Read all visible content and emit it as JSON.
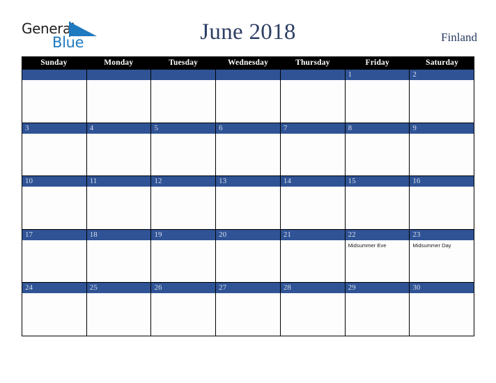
{
  "brand": {
    "word_one": "General",
    "word_two": "Blue",
    "triangle_icon": "blue-triangle-icon",
    "colors": {
      "general_text": "#231f20",
      "blue_text": "#1f7ac0",
      "triangle": "#1f7ac0"
    }
  },
  "header": {
    "title": "June 2018",
    "country": "Finland",
    "title_color": "#2c3e63"
  },
  "theme": {
    "header_row_bg": "#000000",
    "date_bar_bg": "#2f5395",
    "date_bar_text": "#d9dff0",
    "cell_bg": "#fdfdfd",
    "grid_line": "#000000"
  },
  "calendar": {
    "day_headers": [
      "Sunday",
      "Monday",
      "Tuesday",
      "Wednesday",
      "Thursday",
      "Friday",
      "Saturday"
    ],
    "weeks": [
      [
        {
          "day": "",
          "events": []
        },
        {
          "day": "",
          "events": []
        },
        {
          "day": "",
          "events": []
        },
        {
          "day": "",
          "events": []
        },
        {
          "day": "",
          "events": []
        },
        {
          "day": "1",
          "events": []
        },
        {
          "day": "2",
          "events": []
        }
      ],
      [
        {
          "day": "3",
          "events": []
        },
        {
          "day": "4",
          "events": []
        },
        {
          "day": "5",
          "events": []
        },
        {
          "day": "6",
          "events": []
        },
        {
          "day": "7",
          "events": []
        },
        {
          "day": "8",
          "events": []
        },
        {
          "day": "9",
          "events": []
        }
      ],
      [
        {
          "day": "10",
          "events": []
        },
        {
          "day": "11",
          "events": []
        },
        {
          "day": "12",
          "events": []
        },
        {
          "day": "13",
          "events": []
        },
        {
          "day": "14",
          "events": []
        },
        {
          "day": "15",
          "events": []
        },
        {
          "day": "16",
          "events": []
        }
      ],
      [
        {
          "day": "17",
          "events": []
        },
        {
          "day": "18",
          "events": []
        },
        {
          "day": "19",
          "events": []
        },
        {
          "day": "20",
          "events": []
        },
        {
          "day": "21",
          "events": []
        },
        {
          "day": "22",
          "events": [
            "Midsummer Eve"
          ]
        },
        {
          "day": "23",
          "events": [
            "Midsummer Day"
          ]
        }
      ],
      [
        {
          "day": "24",
          "events": []
        },
        {
          "day": "25",
          "events": []
        },
        {
          "day": "26",
          "events": []
        },
        {
          "day": "27",
          "events": []
        },
        {
          "day": "28",
          "events": []
        },
        {
          "day": "29",
          "events": []
        },
        {
          "day": "30",
          "events": []
        }
      ]
    ]
  }
}
